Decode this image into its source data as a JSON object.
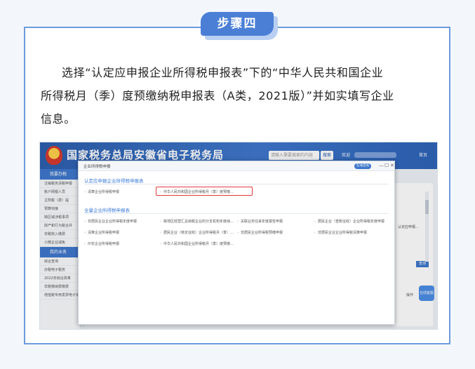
{
  "step": {
    "label": "步骤四"
  },
  "instruction": {
    "line1": "选择“认定应申报企业所得税申报表”下的“中华人民共和国企业",
    "line2": "所得税月（季）度预缴纳税申报表（A类，2021版）”并如实填写企业",
    "line3": "信息。"
  },
  "screenshot": {
    "portal_title": "国家税务总局安徽省电子税务局",
    "top_search_placeholder": "请输入需要搜索的内容",
    "top_search_button": "搜索",
    "top_user_label": "欢迎",
    "top_home": "首页",
    "sidebar": {
      "head1": "我要办税",
      "items1": [
        "注销税务清税申报",
        "账户网银人员",
        "主附税（费）提",
        "预算衔接",
        "跨区域涉税事项",
        "财产和行为税合并",
        "非税收入缴费",
        "小微企业减免"
      ],
      "head2": "我的业务",
      "items2": [
        "综合查询",
        "办税电子税务",
        "2022年综合改革",
        "非税缴纳费缴费",
        "增值税专用发票电子化发行"
      ]
    },
    "background": {
      "side_text": "认定应申报…",
      "query_button": "查询",
      "operation": "操作",
      "float_button": "在线客服"
    },
    "dialog": {
      "title": "企业所得税申报",
      "online_badge": "在线咨询",
      "min_icon": "—",
      "max_icon": "☐",
      "close_icon": "✕",
      "section1": "认定应申报企业所得税申报表",
      "section1_items": [
        "清算企业所得税申报",
        "中华人民共和国企业所得税月（季）度预缴..."
      ],
      "section2": "全量企业所得税申报表",
      "section2_items": [
        "非居民企业企业所得税年度申报",
        "跨地区经营汇总纳税企业的分支机构年度纳…",
        "关联业务往来年度报告申报",
        "居民企业（查账征收）企业所得税年度申报",
        "清算企业所得税申报",
        "居民企业（核定征收）企业所得税月（季）…",
        "非居民企业所得税预缴申报",
        "非居民企业企业所得税清算申报",
        "印花企业所得税申报",
        "中华人民共和国企业所得税月（季）度预缴..."
      ]
    }
  },
  "colors": {
    "accent": "#4b7fd6",
    "frame": "#6d9bdd",
    "highlight": "#e23a3a",
    "link_blue": "#3b7bd8"
  }
}
